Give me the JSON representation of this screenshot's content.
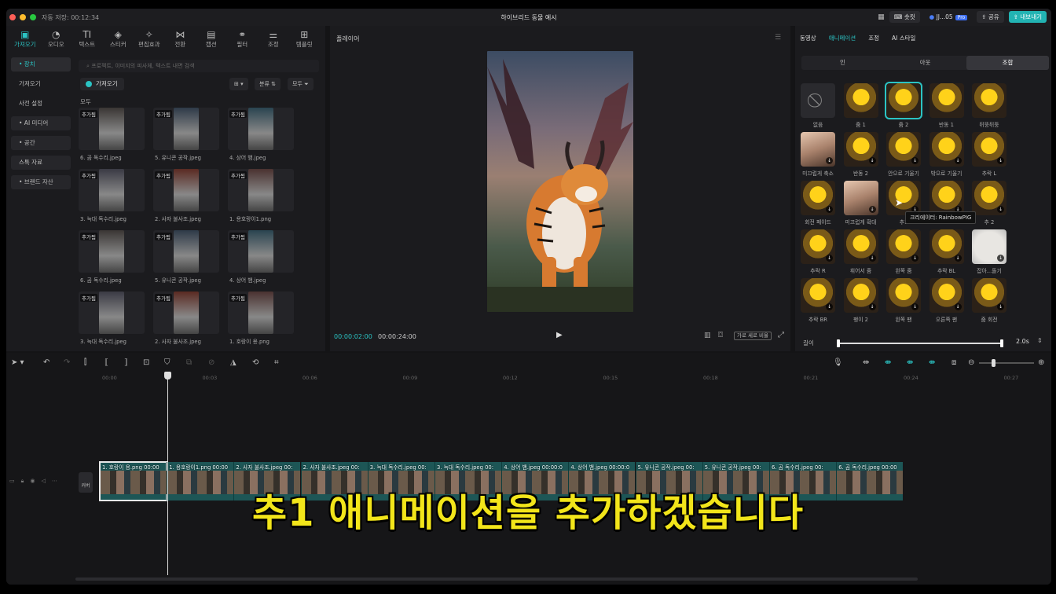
{
  "window": {
    "autosave": "자동 저장: 00:12:34",
    "title": "하이브리드 동물 예시",
    "shortcut_label": "숏컷",
    "user_label": "JJ...05",
    "pro_badge": "Pro",
    "share_label": "공유",
    "export_label": "내보내기",
    "accent": "#2bc4c4"
  },
  "toolbar": {
    "items": [
      {
        "label": "가져오기",
        "icon": "import-icon"
      },
      {
        "label": "오디오",
        "icon": "audio-icon"
      },
      {
        "label": "텍스트",
        "icon": "text-icon"
      },
      {
        "label": "스티커",
        "icon": "sticker-icon"
      },
      {
        "label": "편집효과",
        "icon": "effects-icon"
      },
      {
        "label": "전환",
        "icon": "transition-icon"
      },
      {
        "label": "캡션",
        "icon": "caption-icon"
      },
      {
        "label": "필터",
        "icon": "filter-icon"
      },
      {
        "label": "조정",
        "icon": "adjust-icon"
      },
      {
        "label": "템플릿",
        "icon": "template-icon"
      }
    ]
  },
  "sidebar": {
    "items": [
      {
        "label": "• 장치"
      },
      {
        "label": "가져오기"
      },
      {
        "label": "사전 설정"
      },
      {
        "label": "• AI 미디어"
      },
      {
        "label": "• 공간"
      },
      {
        "label": "스톡 자료"
      },
      {
        "label": "• 브랜드 자산"
      }
    ]
  },
  "media": {
    "search_placeholder": "프로젝트, 이미지의 피사체, 텍스트 내면 검색",
    "import_label": "가져오기",
    "sort_label": "분류",
    "filter_label": "모두",
    "all_label": "모두",
    "added_tag": "추가됨",
    "items": [
      {
        "name": "6. 곰 독수리.jpeg"
      },
      {
        "name": "5. 유니콘 공작.jpeg"
      },
      {
        "name": "4. 상어 뱀.jpeg"
      },
      {
        "name": "3. 늑대 독수리.jpeg"
      },
      {
        "name": "2. 사자 불사조.jpeg"
      },
      {
        "name": "1. 용호랑이1.png"
      },
      {
        "name": "6. 곰 독수리.jpeg"
      },
      {
        "name": "5. 유니콘 공작.jpeg"
      },
      {
        "name": "4. 상어 뱀.jpeg"
      },
      {
        "name": "3. 늑대 독수리.jpeg"
      },
      {
        "name": "2. 사자 불사조.jpeg"
      },
      {
        "name": "1. 호랑이 용.png"
      }
    ]
  },
  "player": {
    "title": "플레이어",
    "current_time": "00:00:02:00",
    "total_time": "00:00:24:00",
    "ratio_label": "가로 세로 비율"
  },
  "inspector": {
    "tabs": [
      "동영상",
      "애니메이션",
      "조정",
      "AI 스타일"
    ],
    "segments": [
      "인",
      "아웃",
      "조합"
    ],
    "animations": [
      {
        "label": "없음",
        "style": "none"
      },
      {
        "label": "줌 1",
        "style": "gold"
      },
      {
        "label": "줌 2",
        "style": "gold"
      },
      {
        "label": "반동 1",
        "style": "gold"
      },
      {
        "label": "뒤뚱뒤뚱",
        "style": "gold"
      },
      {
        "label": "미끄럽게 축소",
        "style": "skin"
      },
      {
        "label": "반동 2",
        "style": "gold"
      },
      {
        "label": "안으로 기울기",
        "style": "gold"
      },
      {
        "label": "밖으로 기울기",
        "style": "gold"
      },
      {
        "label": "추락 L",
        "style": "gold"
      },
      {
        "label": "회전 페이드",
        "style": "gold"
      },
      {
        "label": "미끄럽게 확대",
        "style": "skin"
      },
      {
        "label": "추1",
        "style": "gold"
      },
      {
        "label": "",
        "style": "gold"
      },
      {
        "label": "추 2",
        "style": "gold"
      },
      {
        "label": "추락 R",
        "style": "gold"
      },
      {
        "label": "휘어서 줌",
        "style": "gold"
      },
      {
        "label": "왼쪽 줌",
        "style": "gold"
      },
      {
        "label": "추락 BL",
        "style": "gold"
      },
      {
        "label": "잡아...돌기",
        "style": "white"
      },
      {
        "label": "추락 BR",
        "style": "gold"
      },
      {
        "label": "팽이 2",
        "style": "gold"
      },
      {
        "label": "왼쪽 팬",
        "style": "gold"
      },
      {
        "label": "오른쪽 팬",
        "style": "gold"
      },
      {
        "label": "줌 회전",
        "style": "gold"
      }
    ],
    "tooltip": "크리에이터: RainbowPIG",
    "length_label": "길이",
    "duration_value": "2.0s",
    "duration_fraction": 1.0
  },
  "timeline": {
    "ruler": [
      "00:00",
      "00:03",
      "00:06",
      "00:09",
      "00:12",
      "00:15",
      "00:18",
      "00:21",
      "00:24",
      "00:27"
    ],
    "cover_label": "커버",
    "clips": [
      {
        "name": "1. 호랑이 용.png  00:00"
      },
      {
        "name": "1. 용호랑이1.png  00:00"
      },
      {
        "name": "2. 사자 불사조.jpeg  00:"
      },
      {
        "name": "2. 사자 불사조.jpeg  00:"
      },
      {
        "name": "3. 늑대 독수리.jpeg  00:"
      },
      {
        "name": "3. 늑대 독수리.jpeg  00:"
      },
      {
        "name": "4. 상어 뱀.jpeg  00:00:0"
      },
      {
        "name": "4. 상어 뱀.jpeg  00:00:0"
      },
      {
        "name": "5. 유니콘 공작.jpeg  00:"
      },
      {
        "name": "5. 유니콘 공작.jpeg  00:"
      },
      {
        "name": "6. 곰 독수리.jpeg  00:"
      },
      {
        "name": "6. 곰 독수리.jpeg  00:00"
      }
    ]
  },
  "subtitle": "추1 애니메이션을 추가하겠습니다"
}
